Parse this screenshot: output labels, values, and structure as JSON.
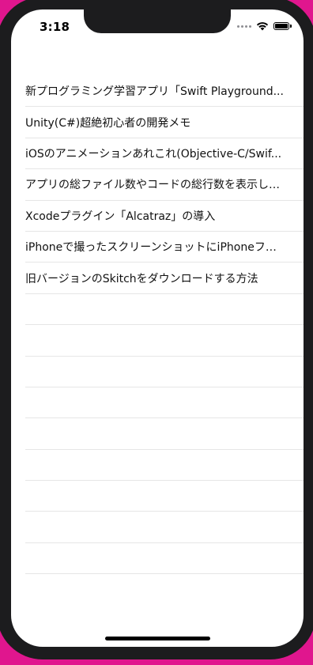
{
  "status_bar": {
    "time": "3:18"
  },
  "list": {
    "items": [
      "新プログラミング学習アプリ「Swift Playground...",
      "Unity(C#)超絶初心者の開発メモ",
      "iOSのアニメーションあれこれ(Objective-C/Swif...",
      "アプリの総ファイル数やコードの総行数を表示し…",
      "Xcodeプラグイン「Alcatraz」の導入",
      "iPhoneで撮ったスクリーンショットにiPhoneフ…",
      "旧バージョンのSkitchをダウンロードする方法",
      "",
      "",
      "",
      "",
      "",
      "",
      "",
      "",
      "",
      ""
    ]
  }
}
